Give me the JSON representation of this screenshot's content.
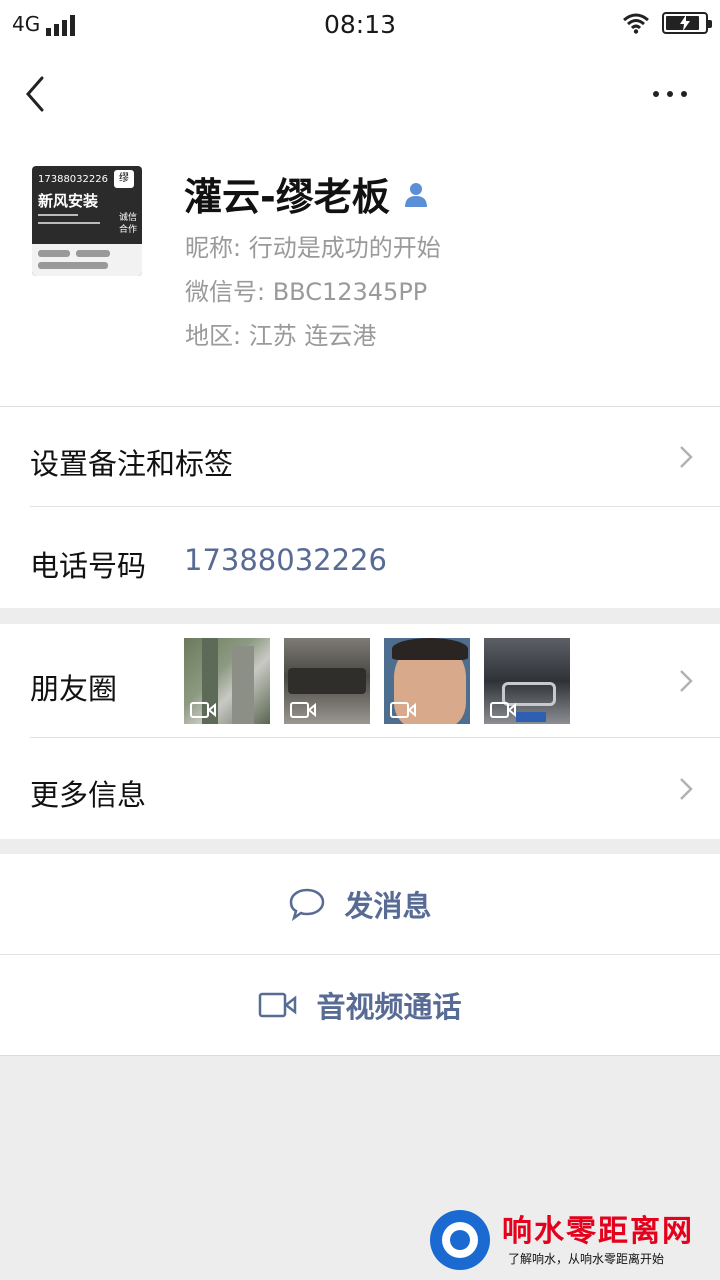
{
  "status_bar": {
    "network": "4G",
    "time": "08:13"
  },
  "profile": {
    "name": "灌云-缪老板",
    "nickname": "昵称:  行动是成功的开始",
    "wechat_id": "微信号:  BBC12345PP",
    "region": "地区:  江苏  连云港",
    "avatar": {
      "phone": "17388032226",
      "title": "新风安装",
      "badge": "缪",
      "side_text": "诚信合作"
    }
  },
  "rows": {
    "remark": "设置备注和标签",
    "phone_label": "电话号码",
    "phone_value": "17388032226",
    "moments": "朋友圈",
    "more_info": "更多信息"
  },
  "actions": {
    "message": "发消息",
    "call": "音视频通话"
  },
  "watermark": {
    "title": "响水零距离网",
    "subtitle": "了解响水，从响水零距离开始"
  },
  "colors": {
    "link": "#576b95",
    "background": "#ededed"
  }
}
